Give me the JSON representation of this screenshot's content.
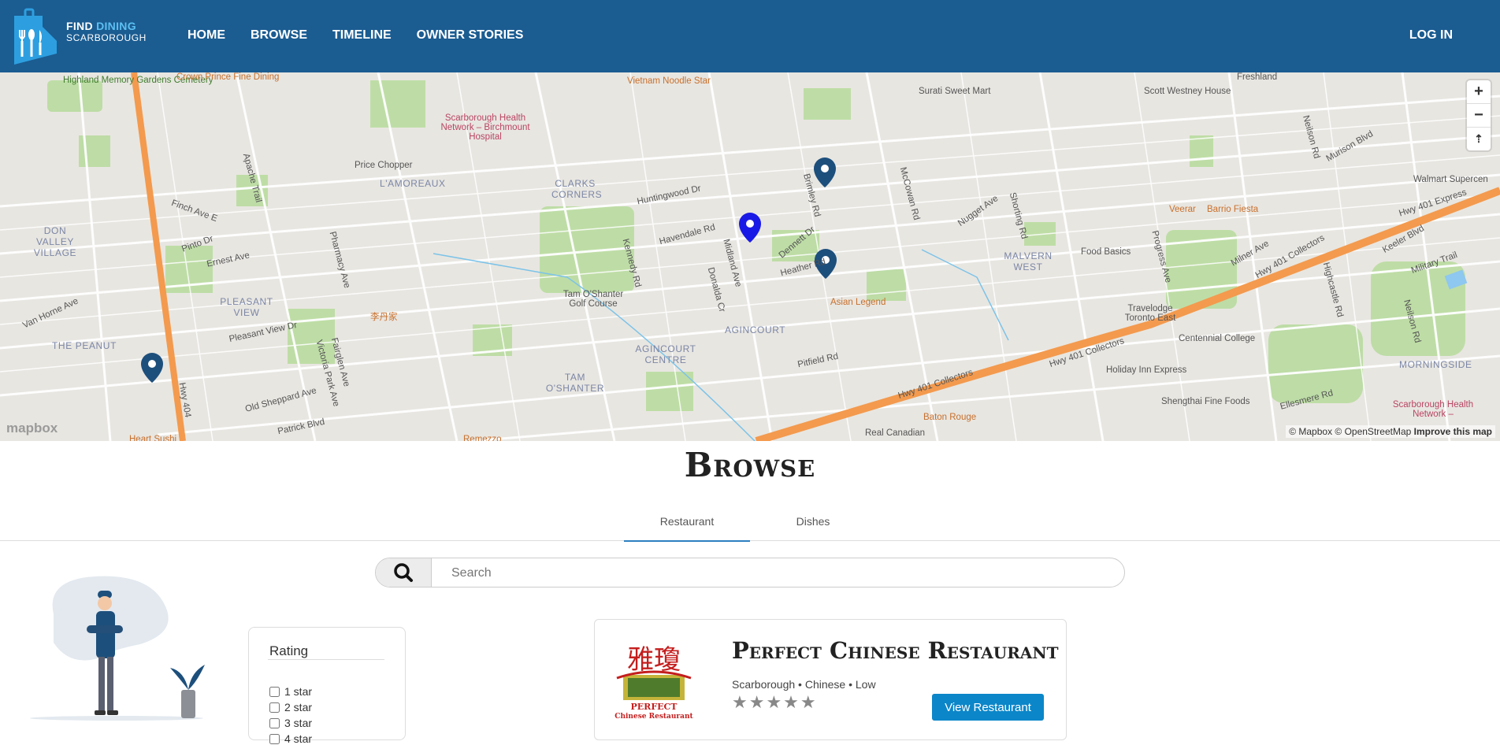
{
  "nav": {
    "brand_line1_a": "FIND",
    "brand_line1_b": "DINING",
    "brand_line2": "SCARBOROUGH",
    "links": [
      "HOME",
      "BROWSE",
      "TIMELINE",
      "OWNER STORIES"
    ],
    "login": "LOG IN"
  },
  "map": {
    "zoom_in": "+",
    "zoom_out": "−",
    "compass": "⇡",
    "attribution": "© Mapbox © OpenStreetMap",
    "improve": "Improve this map",
    "mapbox_logo": "mapbox",
    "labels": {
      "highland": "Highland Memory Gardens Cemetery",
      "crown": "Crown Prince Fine Dining",
      "vietnam": "Vietnam Noodle Star",
      "surati": "Surati Sweet Mart",
      "scott": "Scott Westney House",
      "freshland": "Freshland",
      "hospital": "Scarborough Health Network – Birchmount Hospital",
      "price": "Price Chopper",
      "lamoreaux": "L'AMOREAUX",
      "clarks": "CLARKS CORNERS",
      "huntingwood": "Huntingwood Dr",
      "donvalley": "DON VALLEY VILLAGE",
      "finch": "Finch Ave E",
      "apache": "Apache Trail",
      "pinto": "Pinto Dr",
      "ernest": "Ernest Ave",
      "pharmacy": "Pharmacy Ave",
      "kennedy": "Kennedy Rd",
      "havendale": "Havendale Rd",
      "midland": "Midland Ave",
      "brimley": "Brimley Rd",
      "dennett": "Dennett Dr",
      "mccowan": "McCowan Rd",
      "nugget": "Nugget Ave",
      "shorting": "Shorting Rd",
      "malvern": "MALVERN WEST",
      "foodbasics": "Food Basics",
      "veerar": "Veerar",
      "barrio": "Barrio Fiesta",
      "progress": "Progress Ave",
      "milner": "Milner Ave",
      "hwy401exp": "Hwy 401 Express",
      "hwy401col": "Hwy 401 Collectors",
      "walmart": "Walmart Supercen",
      "morningside": "MORNINGSIDE",
      "neilson": "Neilson Rd",
      "military": "Military Trail",
      "centennial": "Centennial College",
      "travelodge": "Travelodge Toronto East",
      "holiday": "Holiday Inn Express",
      "shengthai": "Shengthai Fine Foods",
      "ellesmere": "Ellesmere Rd",
      "scarbhosp": "Scarborough Health Network –",
      "heather": "Heather Rd",
      "asianlegend": "Asian Legend",
      "agincourt": "AGINCOURT",
      "agincourtcentre": "AGINCOURT CENTRE",
      "tamgolf": "Tam O'Shanter Golf Course",
      "tamoshanter": "TAM O'SHANTER",
      "pleasant": "PLEASANT VIEW",
      "peanut": "THE PEANUT",
      "vanhorne": "Van Horne Ave",
      "pleasantview": "Pleasant View Dr",
      "victoria": "Victoria Park Ave",
      "fairglen": "Fairglen Ave",
      "oldsheppard": "Old Sheppard Ave",
      "patrick": "Patrick Blvd",
      "heartsushi": "Heart Sushi",
      "remezzo": "Remezzo",
      "pitfield": "Pitfield Rd",
      "batonrouge": "Baton Rouge",
      "realcanadian": "Real Canadian",
      "donalda": "Donalda Cr",
      "hwy404": "Hwy 404",
      "chinese": "李丹家",
      "shield404": "404",
      "shield401": "401",
      "highcastle": "Highcastle Rd",
      "keeler": "Keeler Blvd",
      "murison": "Murison Blvd"
    }
  },
  "page": {
    "title": "Browse",
    "tabs": [
      "Restaurant",
      "Dishes"
    ],
    "search_placeholder": "Search"
  },
  "filter": {
    "title": "Rating",
    "options": [
      "1 star",
      "2 star",
      "3 star",
      "4 star"
    ]
  },
  "restaurant": {
    "name": "Perfect Chinese Restaurant",
    "meta": "Scarborough • Chinese • Low",
    "logo_chinese": "雅瓊",
    "logo_line1": "PERFECT",
    "logo_line2": "Chinese Restaurant",
    "rating": 0,
    "stars": "★★★★★",
    "view_button": "View Restaurant"
  },
  "colors": {
    "nav": "#1b5c91",
    "accent": "#0b86c9",
    "marker": "#1d4f7c",
    "marker_selected": "#1a1ae6",
    "highway": "#f7a15a"
  }
}
